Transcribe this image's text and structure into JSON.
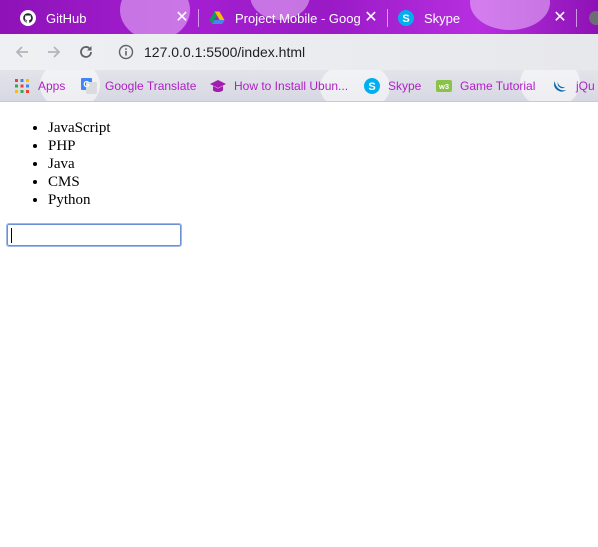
{
  "tabs": [
    {
      "title": "GitHub",
      "icon": "github-icon",
      "close": "✕"
    },
    {
      "title": "Project Mobile - Google",
      "icon": "google-drive-icon",
      "close": "✕"
    },
    {
      "title": "Skype",
      "icon": "skype-icon",
      "close": "✕"
    }
  ],
  "toolbar": {
    "url": "127.0.0.1:5500/index.html",
    "back_icon": "arrow-left-icon",
    "forward_icon": "arrow-right-icon",
    "reload_icon": "reload-icon",
    "info_icon": "info-icon"
  },
  "bookmarks": [
    {
      "label": "Apps",
      "icon": "apps-grid-icon"
    },
    {
      "label": "Google Translate",
      "icon": "google-translate-icon"
    },
    {
      "label": "How to Install Ubun...",
      "icon": "graduation-cap-icon"
    },
    {
      "label": "Skype",
      "icon": "skype-icon"
    },
    {
      "label": "Game Tutorial",
      "icon": "w3schools-icon"
    },
    {
      "label": "jQu",
      "icon": "jquery-icon"
    }
  ],
  "page": {
    "list": [
      "JavaScript",
      "PHP",
      "Java",
      "CMS",
      "Python"
    ],
    "input_value": ""
  },
  "colors": {
    "tabstrip": "#9a1ac6",
    "bookmark_text": "#b11ec8",
    "input_border": "#6c8fd6"
  }
}
